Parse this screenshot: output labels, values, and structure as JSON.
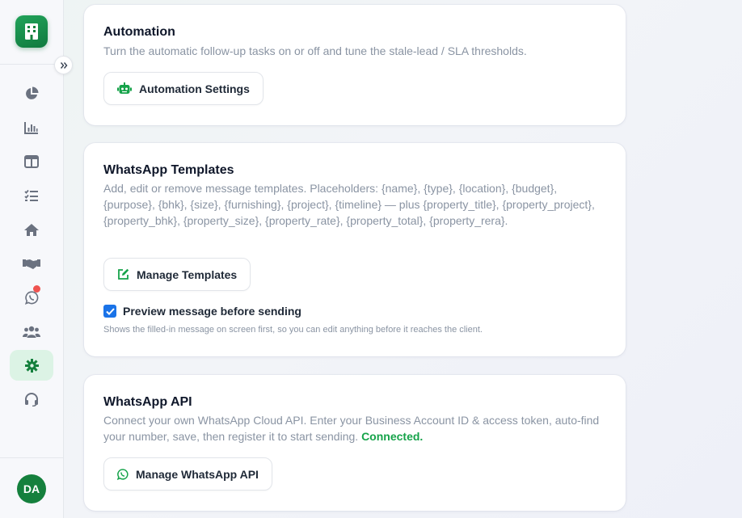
{
  "user": {
    "initials": "DA"
  },
  "sidebar": {
    "items": [
      {
        "icon": "pie-chart-icon"
      },
      {
        "icon": "bar-chart-icon"
      },
      {
        "icon": "columns-icon"
      },
      {
        "icon": "tasks-icon"
      },
      {
        "icon": "home-icon"
      },
      {
        "icon": "handshake-icon"
      },
      {
        "icon": "whatsapp-icon",
        "badge": true
      },
      {
        "icon": "users-icon"
      },
      {
        "icon": "gear-icon",
        "active": true
      },
      {
        "icon": "headset-icon"
      }
    ]
  },
  "automation": {
    "title": "Automation",
    "description": "Turn the automatic follow-up tasks on or off and tune the stale-lead / SLA thresholds.",
    "button_label": "Automation Settings"
  },
  "templates": {
    "title": "WhatsApp Templates",
    "description": "Add, edit or remove message templates. Placeholders: {name}, {type}, {location}, {budget}, {purpose}, {bhk}, {size}, {furnishing}, {project}, {timeline} — plus {property_title}, {property_project}, {property_bhk}, {property_size}, {property_rate}, {property_total}, {property_rera}.",
    "button_label": "Manage Templates",
    "preview_checkbox_label": "Preview message before sending",
    "preview_checked": true,
    "preview_hint": "Shows the filled-in message on screen first, so you can edit anything before it reaches the client."
  },
  "api": {
    "title": "WhatsApp API",
    "description": "Connect your own WhatsApp Cloud API. Enter your Business Account ID & access token, auto-find your number, save, then register it to start sending.",
    "status": "Connected.",
    "button_label": "Manage WhatsApp API"
  },
  "colors": {
    "brand": "#15803d",
    "accent_green": "#16a34a",
    "checkbox": "#1a73e8",
    "badge": "#ef5350"
  }
}
